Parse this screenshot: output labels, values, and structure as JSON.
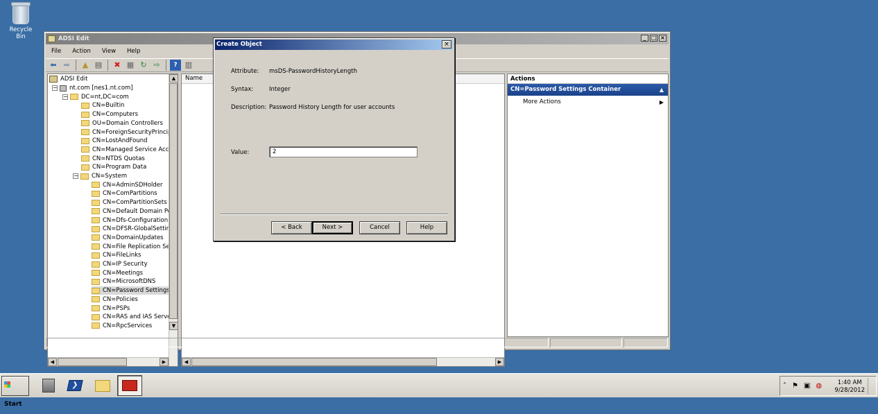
{
  "desktop": {
    "recycle_bin_label": "Recycle Bin"
  },
  "window": {
    "title": "ADSI Edit",
    "controls": {
      "minimize": "_",
      "maximize": "□",
      "close": "×"
    },
    "menu": [
      "File",
      "Action",
      "View",
      "Help"
    ]
  },
  "tree": {
    "root": "ADSI Edit",
    "server": "nt.com [nes1.nt.com]",
    "domain": "DC=nt,DC=com",
    "domain_children": [
      "CN=Builtin",
      "CN=Computers",
      "OU=Domain Controllers",
      "CN=ForeignSecurityPrincipals",
      "CN=LostAndFound",
      "CN=Managed Service Accour",
      "CN=NTDS Quotas",
      "CN=Program Data"
    ],
    "system": "CN=System",
    "system_children": [
      "CN=AdminSDHolder",
      "CN=ComPartitions",
      "CN=ComPartitionSets",
      "CN=Default Domain Polic",
      "CN=Dfs-Configuration",
      "CN=DFSR-GlobalSettings",
      "CN=DomainUpdates",
      "CN=File Replication Servi",
      "CN=FileLinks",
      "CN=IP Security",
      "CN=Meetings",
      "CN=MicrosoftDNS",
      "CN=Password Settings C",
      "CN=Policies",
      "CN=PSPs",
      "CN=RAS and IAS Servers",
      "CN=RpcServices"
    ],
    "selected_item": "CN=Password Settings C"
  },
  "list": {
    "column_name": "Name"
  },
  "actions": {
    "title": "Actions",
    "section": "CN=Password Settings Container",
    "items": [
      "More Actions"
    ]
  },
  "dialog": {
    "title": "Create Object",
    "close": "×",
    "attribute_label": "Attribute:",
    "attribute_value": "msDS-PasswordHistoryLength",
    "syntax_label": "Syntax:",
    "syntax_value": "Integer",
    "description_label": "Description:",
    "description_value": "Password History Length for user accounts",
    "value_label": "Value:",
    "value_input": "2",
    "buttons": {
      "back": "< Back",
      "next": "Next >",
      "cancel": "Cancel",
      "help": "Help"
    }
  },
  "taskbar": {
    "start_label": "Start",
    "time": "1:40 AM",
    "date": "9/28/2012"
  }
}
